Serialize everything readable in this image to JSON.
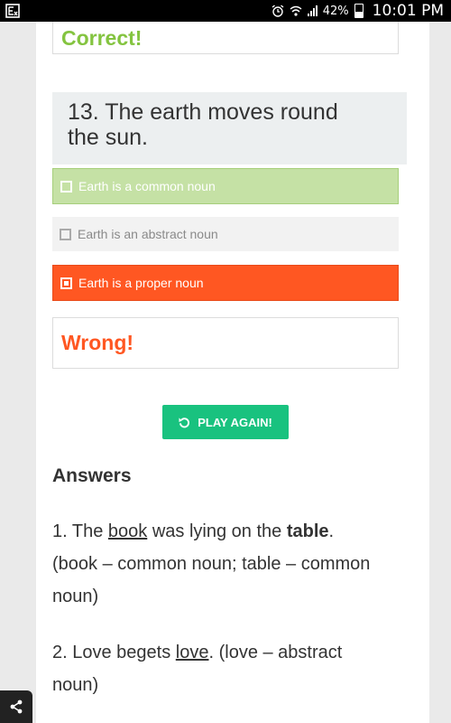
{
  "status_bar": {
    "battery": "42%",
    "time": "10:01 PM"
  },
  "previous_result": {
    "text": "Correct!"
  },
  "question": {
    "line1": "13. The earth moves round",
    "line2": "the sun."
  },
  "options": [
    {
      "label": "Earth is a common noun",
      "state": "correct-answer"
    },
    {
      "label": "Earth is an abstract noun",
      "state": "neutral"
    },
    {
      "label": "Earth is a proper noun",
      "state": "selected-wrong"
    }
  ],
  "result": {
    "text": "Wrong!"
  },
  "play_again": {
    "label": "PLAY AGAIN!"
  },
  "answers": {
    "title": "Answers",
    "item1": {
      "p1": "1. The ",
      "u1": "book",
      "p2": " was lying on the ",
      "b1": "table",
      "p3": ".",
      "line2": "(book – common noun; table – common",
      "line3": "noun)"
    },
    "item2": {
      "p1": "2. Love begets ",
      "u1": "love",
      "p2": ". (love – abstract",
      "line2": "noun)"
    }
  },
  "colors": {
    "correct": "#84c440",
    "wrong": "#ff5722",
    "button": "#19c27f"
  }
}
